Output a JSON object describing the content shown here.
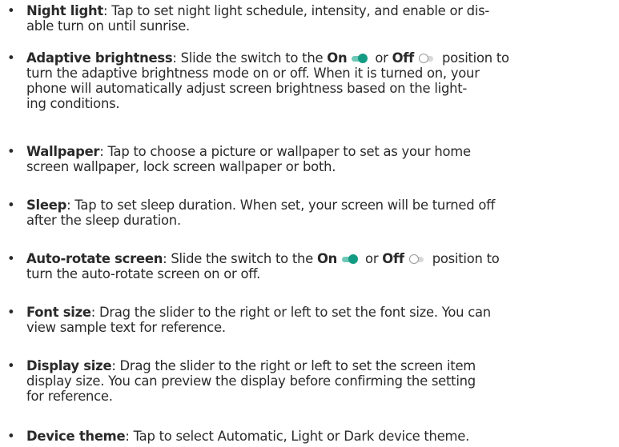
{
  "items": [
    {
      "title": "Night light",
      "lines": [
        ": Tap to set night light schedule, intensity, and enable or dis-",
        "able turn on until sunrise."
      ]
    },
    {
      "title": "Adaptive brightness",
      "line1a": ": Slide the switch to the ",
      "on": "On",
      "or": " or ",
      "off": "Off",
      "line1b": " position to",
      "lines": [
        "turn the adaptive brightness mode on or off. When it is turned on, your",
        "phone will automatically adjust screen brightness based on the light-",
        "ing conditions."
      ]
    },
    {
      "title": "Wallpaper",
      "lines": [
        ": Tap to choose a picture or wallpaper to set as your home",
        "screen wallpaper, lock screen wallpaper or both."
      ]
    },
    {
      "title": "Sleep",
      "lines": [
        ": Tap to set sleep duration. When set, your screen will be turned off",
        "after the sleep duration."
      ]
    },
    {
      "title": "Auto-rotate screen",
      "line1a": ": Slide the switch to the ",
      "on": "On",
      "or": " or ",
      "off": "Off",
      "line1b": " position to",
      "lines": [
        "turn the auto-rotate screen on or off."
      ]
    },
    {
      "title": "Font size",
      "lines": [
        ": Drag the slider to the right or left to set the font size. You can",
        "view sample text for reference."
      ]
    },
    {
      "title": "Display size",
      "lines": [
        ": Drag the slider to the right or left to set the screen item",
        "display size. You can preview the display before confirming the setting",
        "for reference."
      ]
    },
    {
      "title": "Device theme",
      "lines": [
        ": Tap to select Automatic, Light or Dark device theme."
      ]
    }
  ],
  "bullet": "•",
  "colors": {
    "toggle_on": "#149b83",
    "toggle_off": "#9a9a9a"
  }
}
